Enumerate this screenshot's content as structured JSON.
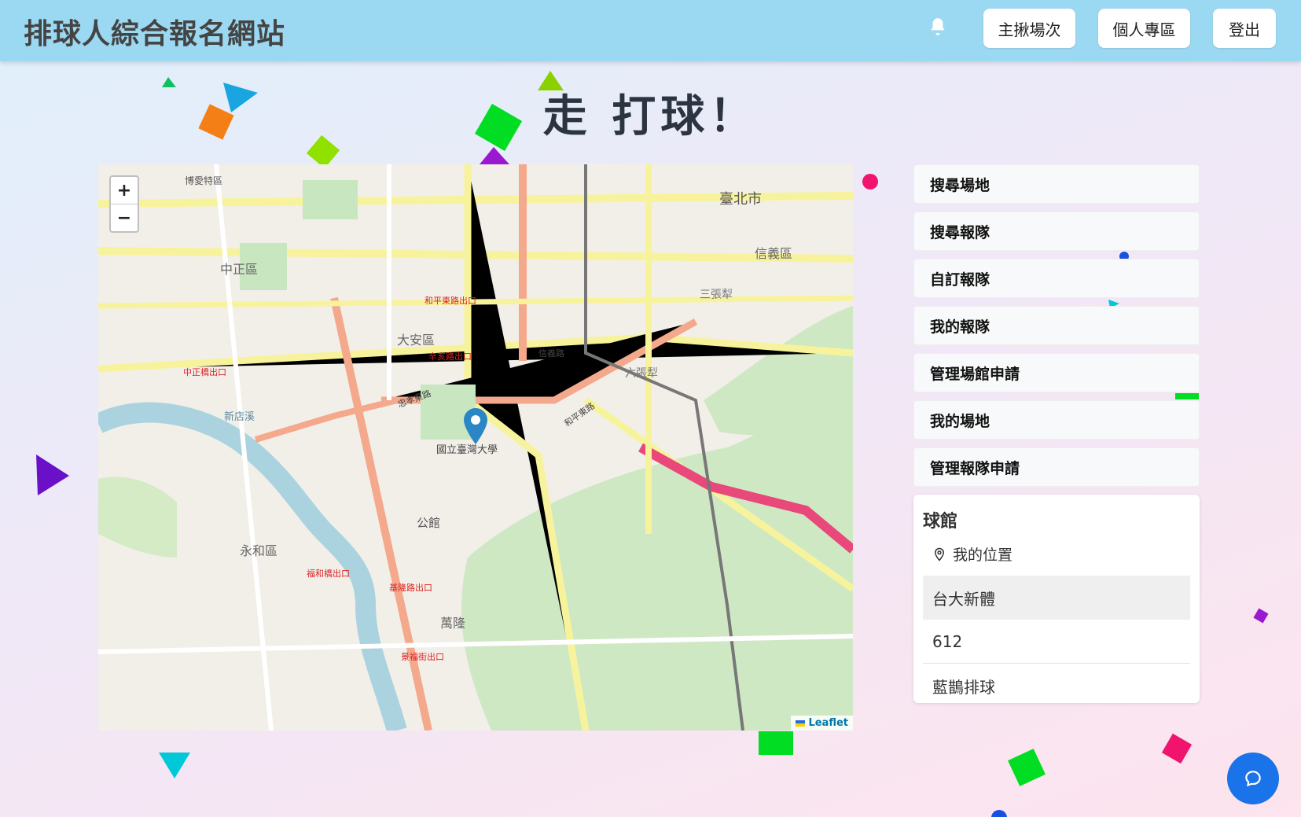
{
  "header": {
    "brand": "排球人綜合報名網站",
    "buttons": [
      "主揪場次",
      "個人專區",
      "登出"
    ]
  },
  "hero": {
    "title": "走 打球！"
  },
  "map": {
    "zoom_in": "+",
    "zoom_out": "−",
    "attribution": "Leaflet",
    "labels": [
      "博愛特區",
      "中正區",
      "大安區",
      "信義區",
      "臺北市",
      "萬隆",
      "公館",
      "新店溪",
      "永和區",
      "國立臺灣大學",
      "辛亥路出口",
      "基隆路出口",
      "和平東路出口",
      "中正橋出口",
      "福和橋出口",
      "景福街出口",
      "六張犁",
      "三張犁",
      "忠孝東路",
      "信義路",
      "和平東路"
    ],
    "marker": "map-pin"
  },
  "sidebar": {
    "items": [
      "搜尋場地",
      "搜尋報隊",
      "自訂報隊",
      "我的報隊",
      "管理場館申請",
      "我的場地",
      "管理報隊申請"
    ]
  },
  "venue": {
    "title": "球館",
    "my_location": "我的位置",
    "rows": [
      "台大新體",
      "612",
      "藍鵲排球"
    ]
  },
  "colors": {
    "navbar": "#9bd8f1",
    "accent": "#1a73e8"
  }
}
